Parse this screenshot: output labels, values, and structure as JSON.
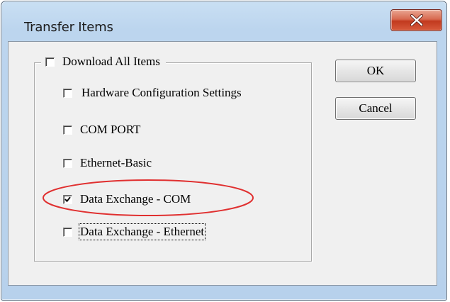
{
  "window": {
    "title": "Transfer Items"
  },
  "group": {
    "legend_label": "Download All Items",
    "legend_checked": false,
    "items": [
      {
        "label": "Hardware Configuration Settings",
        "checked": false
      },
      {
        "label": "COM PORT",
        "checked": false
      },
      {
        "label": "Ethernet-Basic",
        "checked": false
      },
      {
        "label": "Data Exchange - COM",
        "checked": true
      },
      {
        "label": "Data Exchange - Ethernet",
        "checked": false
      }
    ]
  },
  "buttons": {
    "ok": "OK",
    "cancel": "Cancel"
  },
  "icons": {
    "close": "close-icon",
    "check": "checkmark-icon"
  },
  "colors": {
    "highlight": "#e03030",
    "close_button": "#c8452a"
  }
}
